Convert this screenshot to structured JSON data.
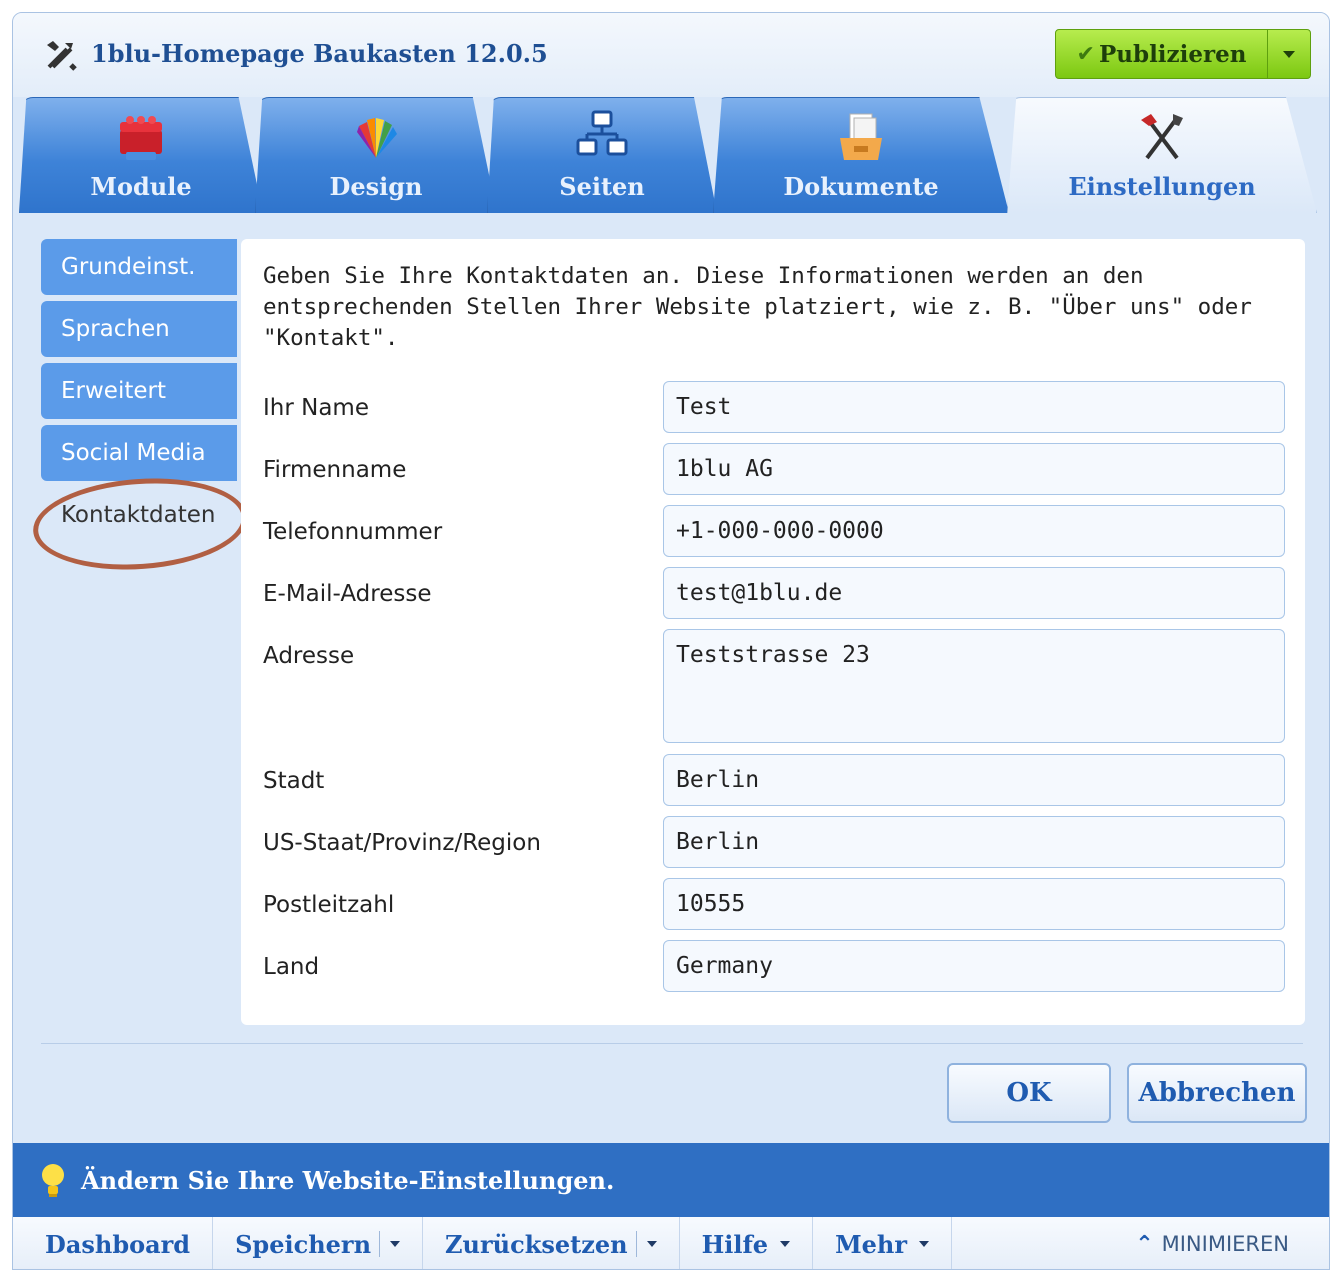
{
  "app": {
    "title": "1blu-Homepage Baukasten 12.0.5"
  },
  "publish": {
    "label": "Publizieren"
  },
  "tabs": [
    {
      "label": "Module",
      "icon": "bricks-icon"
    },
    {
      "label": "Design",
      "icon": "color-palette-icon"
    },
    {
      "label": "Seiten",
      "icon": "sitemap-icon"
    },
    {
      "label": "Dokumente",
      "icon": "documents-box-icon"
    },
    {
      "label": "Einstellungen",
      "icon": "tools-icon"
    }
  ],
  "sidebar": {
    "items": [
      {
        "label": "Grundeinst."
      },
      {
        "label": "Sprachen"
      },
      {
        "label": "Erweitert"
      },
      {
        "label": "Social Media"
      },
      {
        "label": "Kontaktdaten",
        "active": true
      }
    ]
  },
  "form": {
    "intro": "Geben Sie Ihre Kontaktdaten an. Diese Informationen werden an den entsprechenden Stellen Ihrer Website platziert, wie z. B. \"Über uns\" oder \"Kontakt\".",
    "fields": [
      {
        "label": "Ihr Name",
        "value": "Test"
      },
      {
        "label": "Firmenname",
        "value": "1blu AG"
      },
      {
        "label": "Telefonnummer",
        "value": "+1-000-000-0000"
      },
      {
        "label": "E-Mail-Adresse",
        "value": "test@1blu.de"
      },
      {
        "label": "Adresse",
        "value": "Teststrasse 23"
      },
      {
        "label": "Stadt",
        "value": "Berlin"
      },
      {
        "label": "US-Staat/Provinz/Region",
        "value": "Berlin"
      },
      {
        "label": "Postleitzahl",
        "value": "10555"
      },
      {
        "label": "Land",
        "value": "Germany"
      }
    ]
  },
  "buttons": {
    "ok": "OK",
    "cancel": "Abbrechen"
  },
  "status": {
    "text": "Ändern Sie Ihre Website-Einstellungen."
  },
  "bottombar": {
    "items": [
      "Dashboard",
      "Speichern",
      "Zurücksetzen",
      "Hilfe",
      "Mehr"
    ],
    "minimize": "MINIMIEREN"
  },
  "colors": {
    "accent": "#2f6fc3",
    "publish": "#8fd11e",
    "highlight": "#b15f43"
  }
}
